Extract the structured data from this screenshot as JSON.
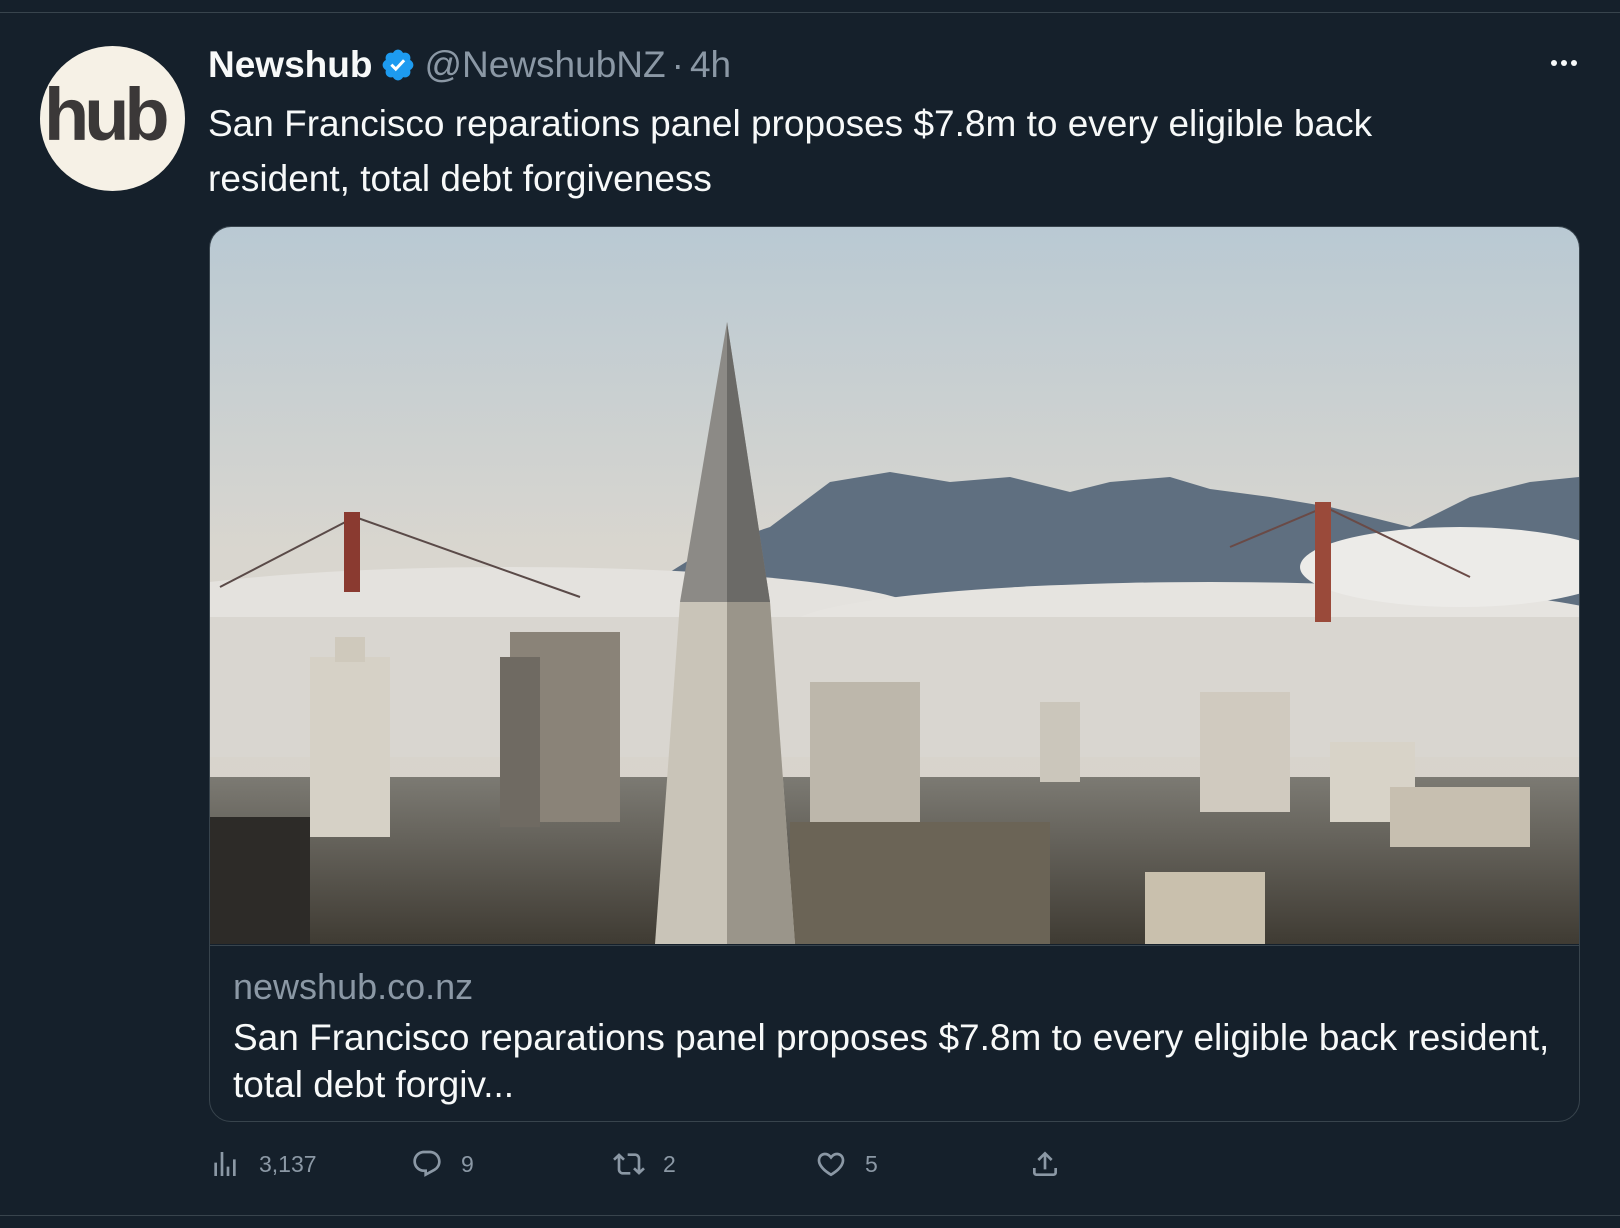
{
  "account": {
    "avatar_text": "hub",
    "name": "Newshub",
    "handle": "@NewshubNZ",
    "separator": "·",
    "time": "4h",
    "verified": true
  },
  "tweet": {
    "text": "San Francisco reparations panel proposes $7.8m to every eligible back resident, total debt forgiveness"
  },
  "card": {
    "image": "san-francisco-skyline-fog-photo",
    "domain": "newshub.co.nz",
    "title": "San Francisco reparations panel proposes $7.8m to every eligible back resident, total debt forgiv..."
  },
  "actions": {
    "views": "3,137",
    "replies": "9",
    "retweets": "2",
    "likes": "5"
  },
  "colors": {
    "background": "#15202b",
    "verified": "#1d9bf0",
    "muted": "#8b98a5",
    "text": "#f7f9f9",
    "border": "#38444d"
  }
}
